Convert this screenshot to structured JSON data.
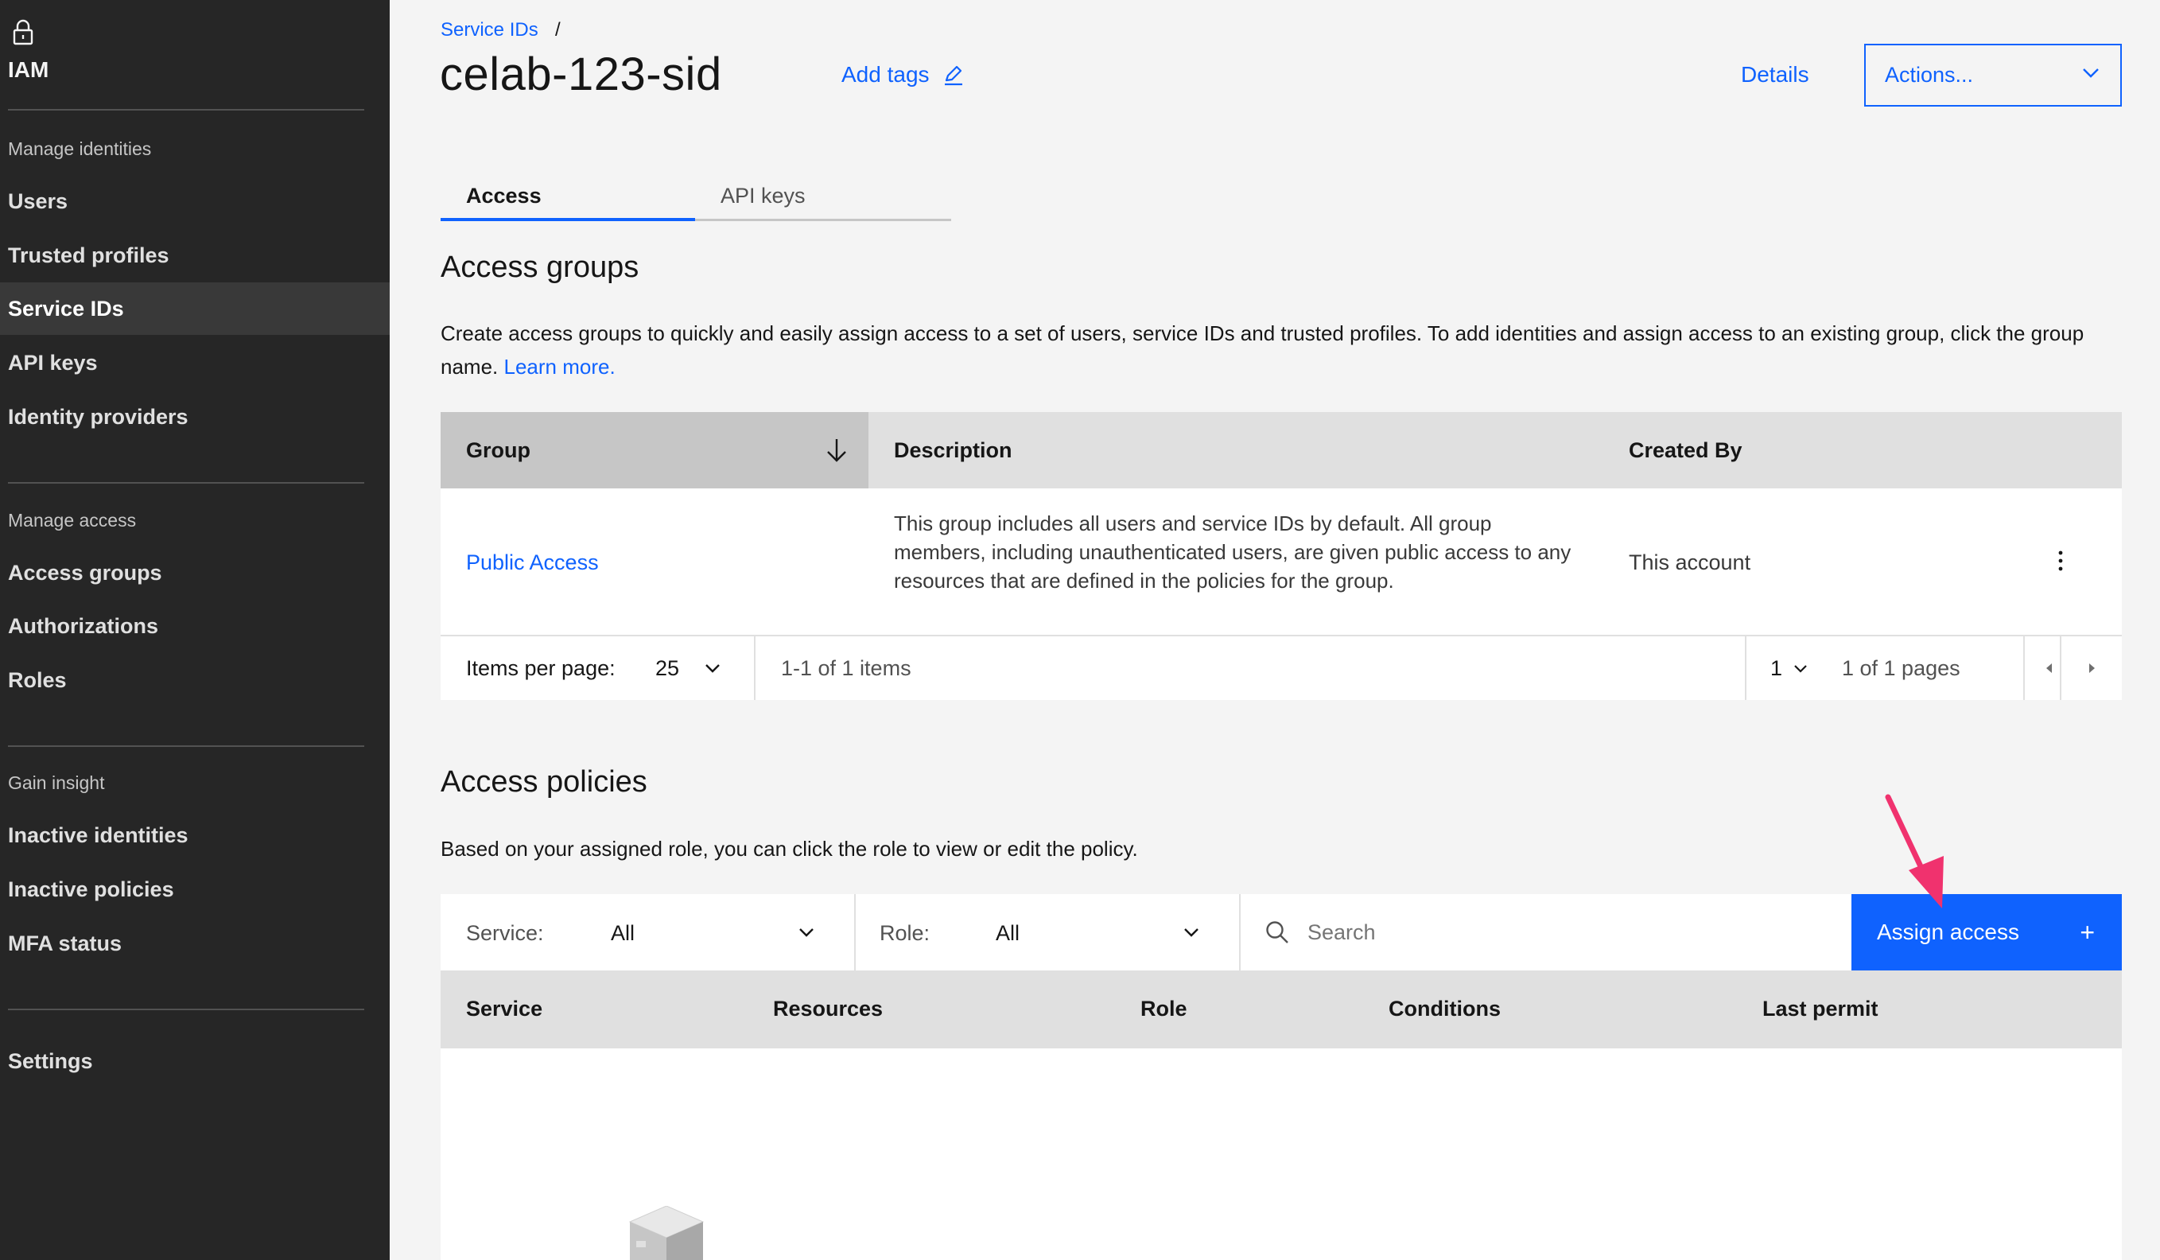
{
  "sidebar": {
    "title": "IAM",
    "sections": {
      "manage_identities": "Manage identities",
      "manage_access": "Manage access",
      "gain_insight": "Gain insight"
    },
    "items": {
      "users": "Users",
      "trusted_profiles": "Trusted profiles",
      "service_ids": "Service IDs",
      "api_keys": "API keys",
      "identity_providers": "Identity providers",
      "access_groups": "Access groups",
      "authorizations": "Authorizations",
      "roles": "Roles",
      "inactive_identities": "Inactive identities",
      "inactive_policies": "Inactive policies",
      "mfa_status": "MFA status",
      "settings": "Settings"
    },
    "active_item": "Service IDs"
  },
  "header": {
    "breadcrumb": "Service IDs",
    "breadcrumb_sep": "/",
    "title": "celab-123-sid",
    "add_tags": "Add tags",
    "details": "Details",
    "actions": "Actions..."
  },
  "tabs": {
    "access": "Access",
    "api_keys": "API keys"
  },
  "access_groups": {
    "heading": "Access groups",
    "description": "Create access groups to quickly and easily assign access to a set of users, service IDs and trusted profiles. To add identities and assign access to an existing group, click the group name.",
    "learn_more": "Learn more.",
    "columns": {
      "group": "Group",
      "description": "Description",
      "created_by": "Created By"
    },
    "rows": [
      {
        "group": "Public Access",
        "description": "This group includes all users and service IDs by default. All group members, including unauthenticated users, are given public access to any resources that are defined in the policies for the group.",
        "created_by": "This account"
      }
    ],
    "pagination": {
      "items_per_page_label": "Items per page:",
      "items_per_page": "25",
      "range": "1-1 of 1 items",
      "page": "1",
      "pages": "1 of 1 pages"
    }
  },
  "access_policies": {
    "heading": "Access policies",
    "description": "Based on your assigned role, you can click the role to view or edit the policy.",
    "filters": {
      "service_label": "Service:",
      "service_value": "All",
      "role_label": "Role:",
      "role_value": "All",
      "search_placeholder": "Search"
    },
    "assign_button": "Assign access",
    "assign_plus": "+",
    "columns": {
      "service": "Service",
      "resources": "Resources",
      "role": "Role",
      "conditions": "Conditions",
      "last_permit": "Last permit"
    }
  },
  "colors": {
    "accent": "#0f62fe",
    "sidebar_bg": "#262626",
    "annotation_arrow": "#f0326e"
  }
}
